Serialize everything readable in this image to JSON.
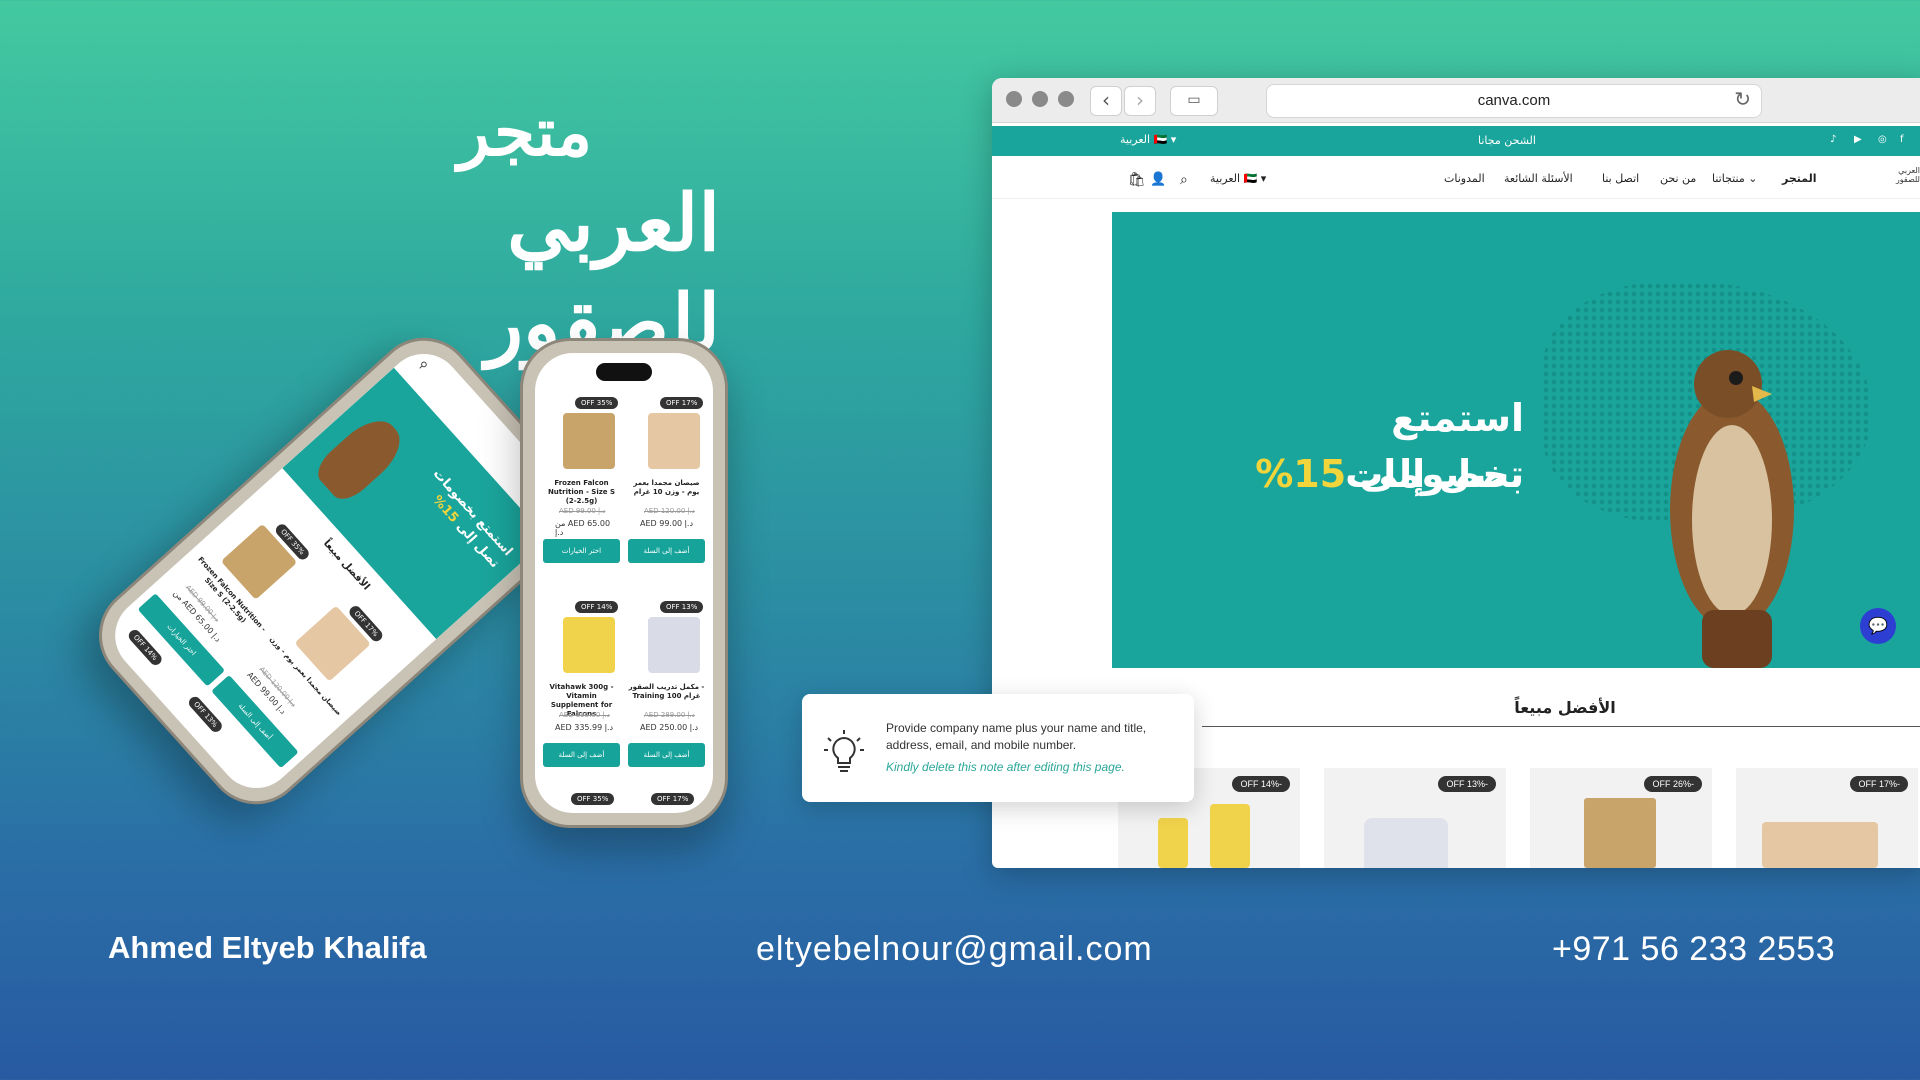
{
  "headline": {
    "line1": "متجر",
    "line2": "العربي للصقور"
  },
  "contact": {
    "name": "Ahmed Eltyeb Khalifa",
    "email": "eltyebelnour@gmail.com",
    "phone": "+971 56 233 2553"
  },
  "browser": {
    "url": "canva.com",
    "topbar": {
      "shipping": "الشحن مجانا",
      "language": "العربية"
    },
    "nav": {
      "store": "المتجر",
      "products": "منتجاتنا",
      "about": "من نحن",
      "contact": "اتصل بنا",
      "faq": "الأسئلة الشائعة",
      "blogs": "المدونات",
      "language": "العربية",
      "logo_line1": "العربي",
      "logo_line2": "للصقور"
    },
    "hero": {
      "line1": "استمتع بخصومات",
      "line2_text": "تصل إلى",
      "line2_pct": "15%"
    },
    "best_sellers": "الأفضل مبيعاً",
    "product_badges": [
      "OFF 14%-",
      "OFF 13%-",
      "OFF 26%-",
      "OFF 17%-"
    ]
  },
  "note": {
    "text": "Provide company name plus your name and title, address, email, and mobile number.",
    "hint": "Kindly delete this note after editing this page."
  },
  "phone2": {
    "products": [
      {
        "badge": "OFF 35%",
        "title": "Frozen Falcon Nutrition - Size S (2-2.5g)",
        "old": "AED د.إ 99.00",
        "price": "من AED 65.00 د.إ",
        "button": "اختر الخيارات"
      },
      {
        "badge": "OFF 17%",
        "title": "صيصان مجمدا بعمر يوم - وزن 10 غرام",
        "old": "AED د.إ 120.00",
        "price": "AED د.إ 99.00",
        "button": "أضف إلى السلة"
      },
      {
        "badge": "OFF 14%",
        "title": "Vitahawk 300g - Vitamin Supplement for Falcons",
        "old": "AED د.إ 395.00",
        "price": "AED د.إ 335.99",
        "button": "أضف إلى السلة"
      },
      {
        "badge": "OFF 13%",
        "title": "مكمل تدريب الصقور - Training 100 غرام",
        "old": "AED د.إ 289.00",
        "price": "AED د.إ 250.00",
        "button": "أضف إلى السلة"
      }
    ],
    "bottom_badges": [
      "OFF 35%",
      "OFF 17%"
    ]
  },
  "phone1": {
    "hero_line1": "استمتع بخصومات",
    "hero_line2": "تصل إلى",
    "hero_pct": "15%",
    "best": "الأفضل مبيعاً",
    "products": [
      {
        "badge": "OFF 35%",
        "title": "Frozen Falcon Nutrition - Size S (2-2.5g)",
        "old": "AED د.إ 99.00",
        "price": "من AED 65.00 د.إ",
        "button": "اختر الخيارات"
      },
      {
        "badge": "OFF 17%",
        "title": "صيصان مجمدا بعمر يوم - وزن",
        "old": "AED د.إ 120.00",
        "price": "AED د.إ 99.00",
        "button": "أضف إلى السلة"
      }
    ],
    "bottom_badges": [
      "OFF 14%",
      "OFF 13%"
    ]
  }
}
